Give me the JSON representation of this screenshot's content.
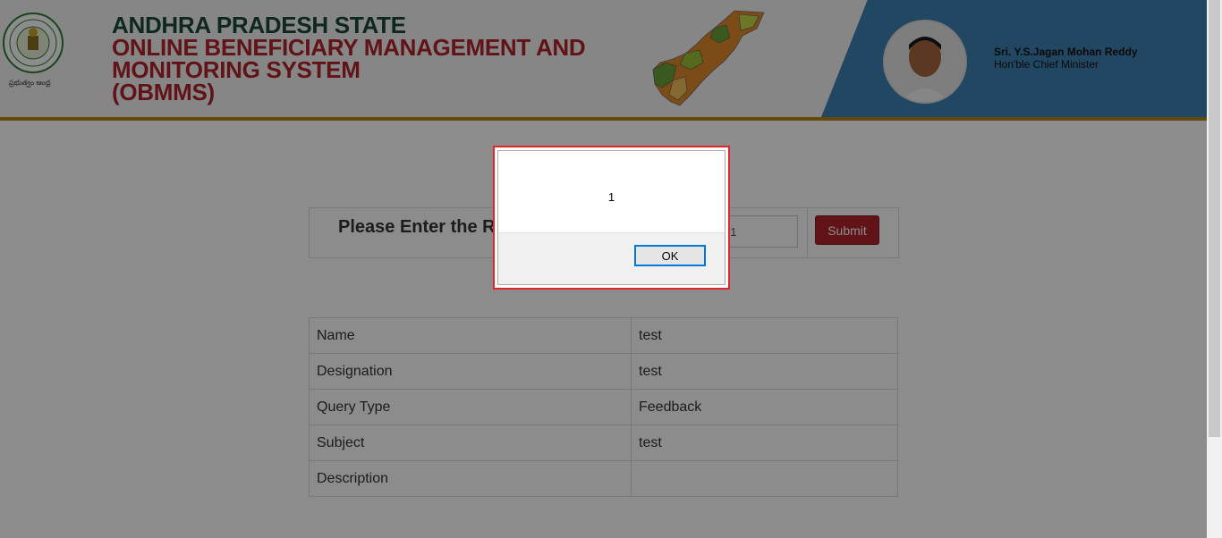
{
  "header": {
    "title_line1": "ANDHRA PRADESH STATE",
    "title_line2": "ONLINE BENEFICIARY MANAGEMENT AND",
    "title_line3": "MONITORING SYSTEM",
    "title_line4": "(OBMMS)",
    "emblem_icon": "government-seal-icon",
    "emblem_text": "ప్రభుత్వం ఆంధ్ర",
    "map_icon": "andhra-pradesh-map-icon",
    "cm_name": "Sri. Y.S.Jagan Mohan Reddy",
    "cm_role": "Hon'ble Chief Minister",
    "panel_color": "#3f82b3",
    "accent_red": "#b3232a",
    "accent_green": "#1b4a3a"
  },
  "search": {
    "label": "Please Enter the R",
    "input_value": "51",
    "submit_label": "Submit"
  },
  "details": {
    "rows": [
      {
        "key": "Name",
        "value": "test"
      },
      {
        "key": "Designation",
        "value": "test"
      },
      {
        "key": "Query Type",
        "value": "Feedback"
      },
      {
        "key": "Subject",
        "value": "test"
      },
      {
        "key": "Description",
        "value": ""
      }
    ]
  },
  "dialog": {
    "message": "1",
    "ok_label": "OK"
  }
}
